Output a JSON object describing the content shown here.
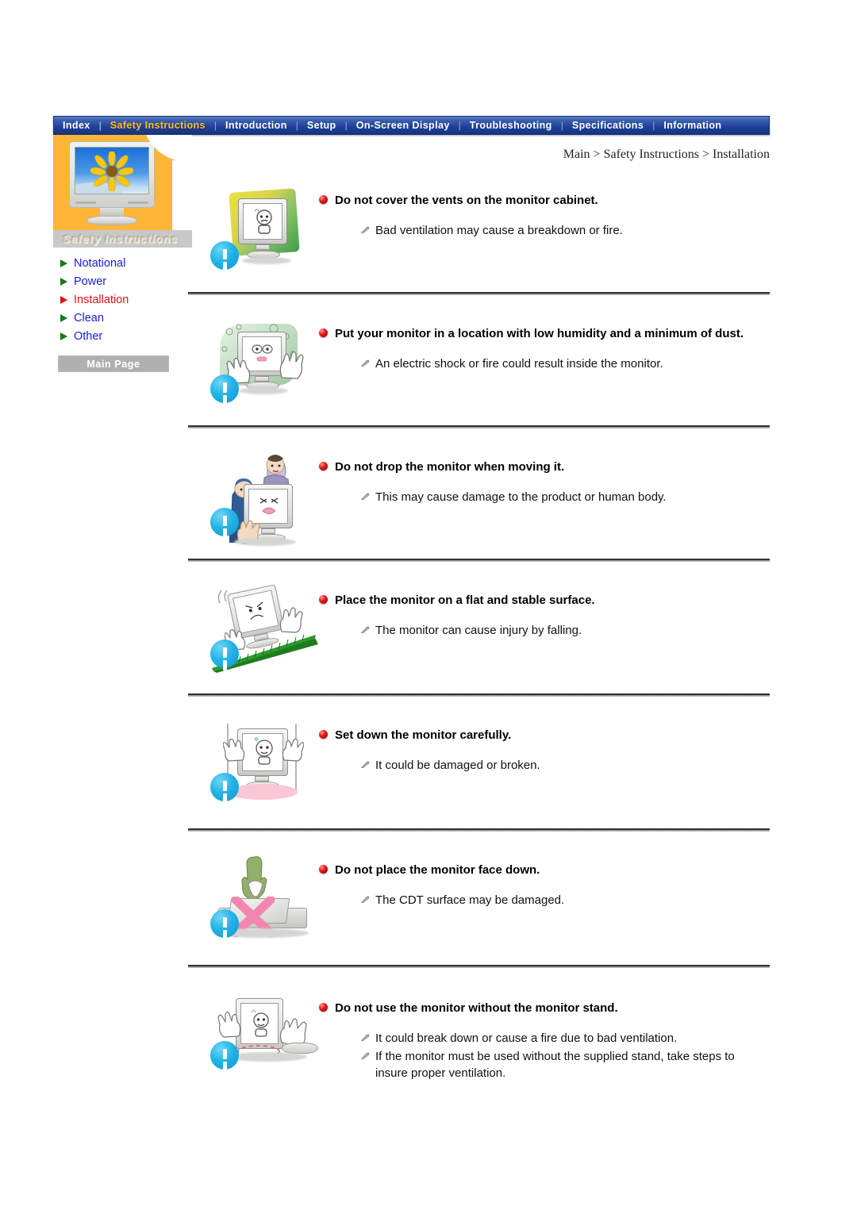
{
  "nav": {
    "items": [
      {
        "label": "Index",
        "active": false
      },
      {
        "label": "Safety Instructions",
        "active": true
      },
      {
        "label": "Introduction",
        "active": false
      },
      {
        "label": "Setup",
        "active": false
      },
      {
        "label": "On-Screen Display",
        "active": false
      },
      {
        "label": "Troubleshooting",
        "active": false
      },
      {
        "label": "Specifications",
        "active": false
      },
      {
        "label": "Information",
        "active": false
      }
    ],
    "separator": "|"
  },
  "sidebar": {
    "logo_caption": "Safety Instructions",
    "items": [
      {
        "label": "Notational",
        "current": false
      },
      {
        "label": "Power",
        "current": false
      },
      {
        "label": "Installation",
        "current": true
      },
      {
        "label": "Clean",
        "current": false
      },
      {
        "label": "Other",
        "current": false
      }
    ],
    "main_page_button": "Main Page"
  },
  "breadcrumb": "Main > Safety Instructions > Installation",
  "colors": {
    "nav_bg": "#20409a",
    "nav_active_text": "#ffc21e",
    "sidebar_panel": "#ffb537",
    "link_blue": "#1a1ae0",
    "current_red": "#e61010",
    "bullet_red": "#ec2020",
    "warning_blue": "#23b3e6"
  },
  "sections": [
    {
      "icon": "monitor-covered-with-cloth-illustration",
      "heading": "Do not cover the vents on the monitor cabinet.",
      "bullets": [
        "Bad ventilation may cause a breakdown or fire."
      ]
    },
    {
      "icon": "monitor-in-dusty-humid-place-illustration",
      "heading": "Put your monitor in a location with low humidity and a minimum of dust.",
      "bullets": [
        "An electric shock or fire could result inside the monitor."
      ]
    },
    {
      "icon": "person-dropping-monitor-illustration",
      "heading": "Do not drop the monitor when moving it.",
      "bullets": [
        "This may cause damage to the product or human body."
      ]
    },
    {
      "icon": "monitor-on-sloped-surface-illustration",
      "heading": "Place the monitor on a flat and stable surface.",
      "bullets": [
        "The monitor can cause injury by falling."
      ]
    },
    {
      "icon": "monitor-being-set-down-illustration",
      "heading": "Set down the monitor carefully.",
      "bullets": [
        "It could be damaged or broken."
      ]
    },
    {
      "icon": "monitor-face-down-crossed-out-illustration",
      "heading": "Do not place the monitor face down.",
      "bullets": [
        "The CDT surface may be damaged."
      ]
    },
    {
      "icon": "monitor-without-stand-illustration",
      "heading": "Do not use the monitor without the monitor stand.",
      "bullets": [
        "It could break down or cause a fire due to bad ventilation.",
        "If the monitor must be used without the supplied stand, take steps to insure proper ventilation."
      ]
    }
  ]
}
